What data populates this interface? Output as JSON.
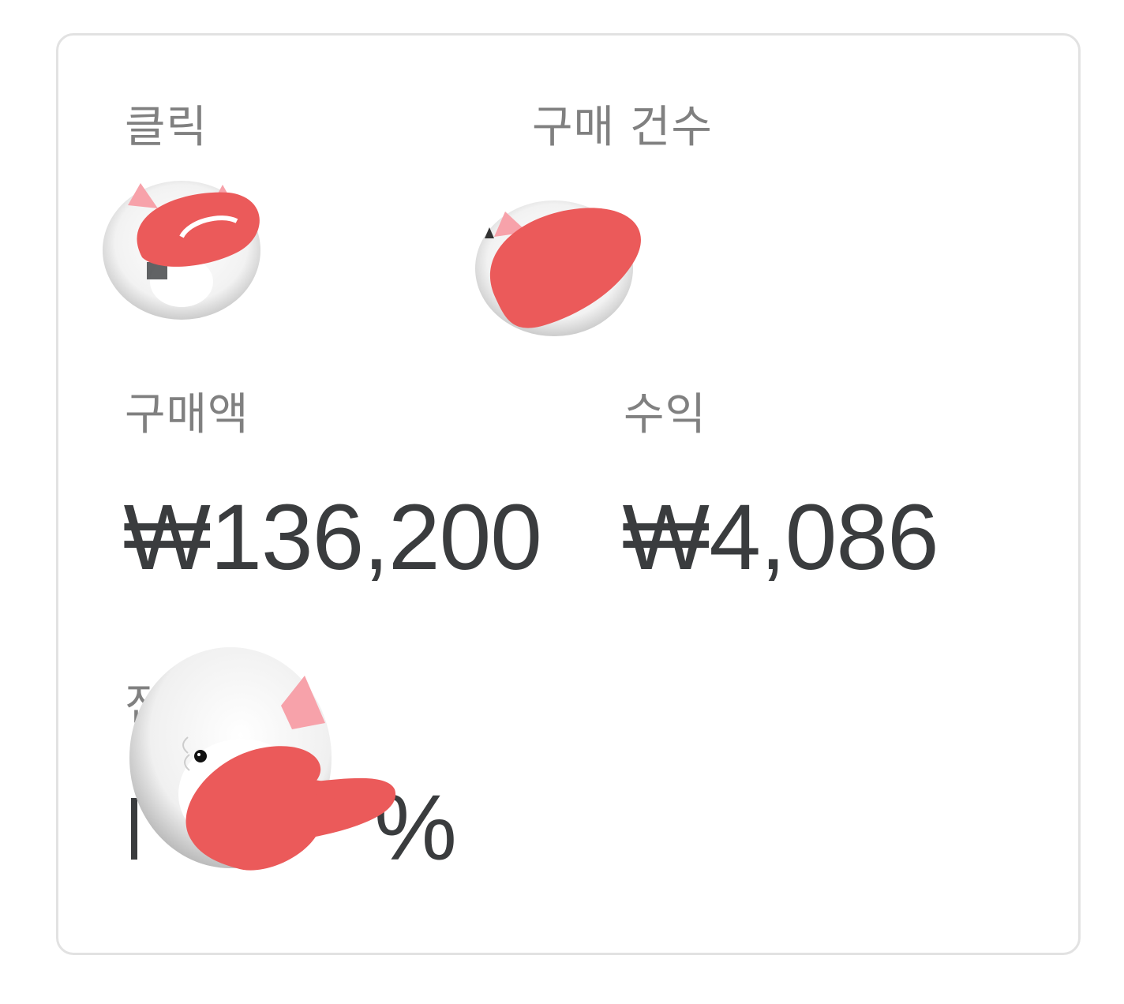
{
  "metrics": {
    "clicks": {
      "label": "클릭"
    },
    "purchase_count": {
      "label": "구매 건수"
    },
    "purchase_amount": {
      "label": "구매액",
      "value": "₩136,200"
    },
    "revenue": {
      "label": "수익",
      "value": "₩4,086"
    },
    "conversion_rate": {
      "label": "전환율",
      "value_suffix": "%"
    }
  },
  "stickers": {
    "icon": "cat-sticker-icon",
    "count": 3
  },
  "colors": {
    "redaction": "#eb5a5a",
    "label_text": "#808080",
    "value_text": "#3a3c3e",
    "card_border": "#e2e2e2"
  }
}
